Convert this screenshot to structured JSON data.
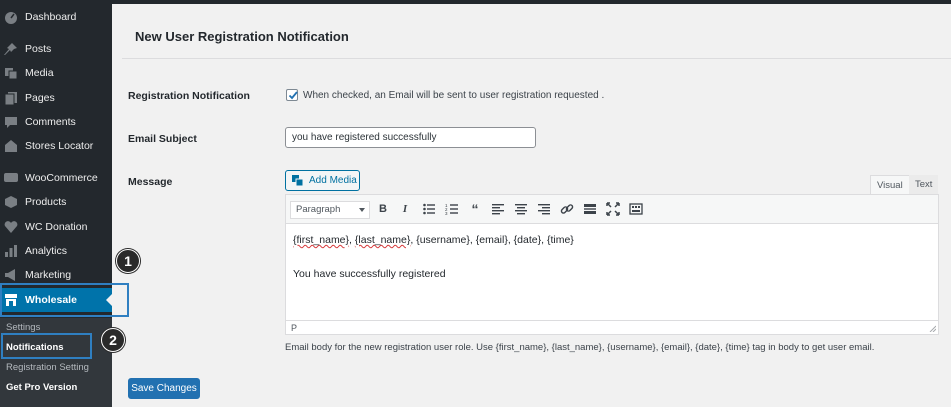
{
  "sidebar": {
    "items": [
      {
        "label": "Dashboard",
        "icon": "dashboard-icon"
      },
      {
        "label": "Posts",
        "icon": "pin-icon"
      },
      {
        "label": "Media",
        "icon": "media-icon"
      },
      {
        "label": "Pages",
        "icon": "pages-icon"
      },
      {
        "label": "Comments",
        "icon": "comment-icon"
      },
      {
        "label": "Stores Locator",
        "icon": "stores-icon"
      },
      {
        "label": "WooCommerce",
        "icon": "woocommerce-icon"
      },
      {
        "label": "Products",
        "icon": "products-icon"
      },
      {
        "label": "WC Donation",
        "icon": "heart-icon"
      },
      {
        "label": "Analytics",
        "icon": "analytics-icon"
      },
      {
        "label": "Marketing",
        "icon": "megaphone-icon"
      },
      {
        "label": "Wholesale",
        "icon": "store-icon"
      }
    ],
    "submenu": [
      "Settings",
      "Notifications",
      "Registration Setting",
      "Get Pro Version"
    ]
  },
  "callouts": [
    "1",
    "2"
  ],
  "page": {
    "title": "New User Registration Notification",
    "registration_label": "Registration Notification",
    "checkbox_checked": true,
    "checkbox_text": "When checked, an Email will be sent to user registration requested .",
    "subject_label": "Email Subject",
    "subject_value": "you have registered successfully",
    "message_label": "Message",
    "add_media": "Add Media",
    "tab_visual": "Visual",
    "tab_text": "Text",
    "format": "Paragraph",
    "body_first_name": "{first_name}",
    "body_sep1": ", ",
    "body_last_name": "{last_name}",
    "body_rest": ", {username}, {email}, {date}, {time}",
    "body_line2": "You have successfully registered",
    "status_path": "P",
    "help": "Email body for the new registration user role. Use {first_name}, {last_name}, {username}, {email}, {date}, {time} tag in body to get user email.",
    "save": "Save Changes"
  },
  "colors": {
    "accent": "#0073aa",
    "sidebar": "#23282d",
    "callout": "#2f7fc1"
  }
}
